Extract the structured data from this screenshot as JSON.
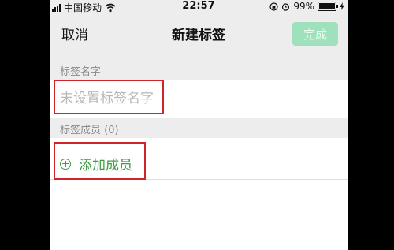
{
  "status_bar": {
    "carrier": "中国移动",
    "time": "22:57",
    "battery": "99%",
    "battery_level": 0.99
  },
  "nav": {
    "cancel_label": "取消",
    "title": "新建标签",
    "done_label": "完成"
  },
  "name_section": {
    "label": "标签名字",
    "placeholder": "未设置标签名字",
    "value": ""
  },
  "members_section": {
    "label": "标签成员 (0)",
    "add_label": "添加成员"
  },
  "colors": {
    "accent_green": "#3e9c46",
    "done_button_disabled": "#9fe1bc",
    "highlight_red": "#d0232a"
  },
  "icons": [
    "signal-icon",
    "wifi-icon",
    "rotation-lock-icon",
    "alarm-icon",
    "battery-icon",
    "charging-icon",
    "add-circle-icon"
  ]
}
